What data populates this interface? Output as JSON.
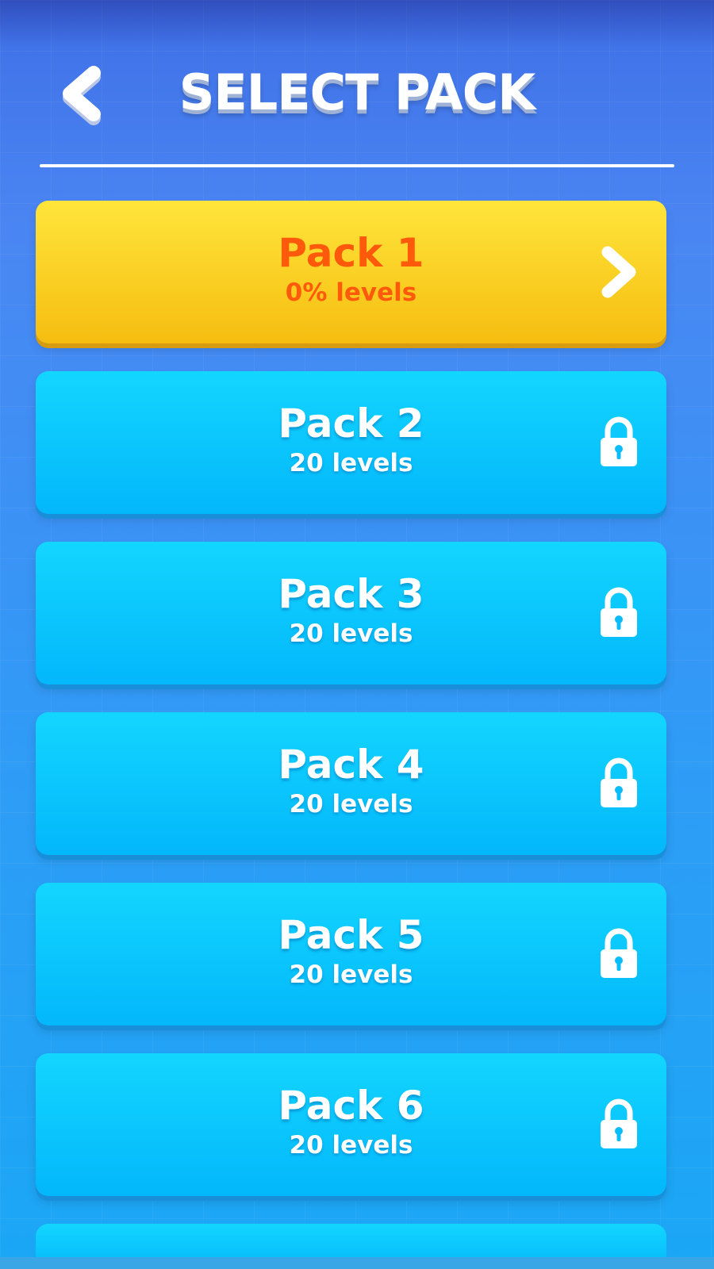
{
  "header": {
    "title": "SELECT PACK",
    "back_icon": "chevron-left-icon"
  },
  "colors": {
    "background": "#3f86f2",
    "active_pack": "#f9c91c",
    "active_text": "#ff5a0b",
    "locked_pack": "#0ac6fd",
    "locked_text": "#ffffff"
  },
  "packs": [
    {
      "name": "Pack 1",
      "subtitle": "0% levels",
      "state": "unlocked",
      "icon": "chevron-right-icon"
    },
    {
      "name": "Pack 2",
      "subtitle": "20 levels",
      "state": "locked",
      "icon": "lock-icon"
    },
    {
      "name": "Pack 3",
      "subtitle": "20 levels",
      "state": "locked",
      "icon": "lock-icon"
    },
    {
      "name": "Pack 4",
      "subtitle": "20 levels",
      "state": "locked",
      "icon": "lock-icon"
    },
    {
      "name": "Pack 5",
      "subtitle": "20 levels",
      "state": "locked",
      "icon": "lock-icon"
    },
    {
      "name": "Pack 6",
      "subtitle": "20 levels",
      "state": "locked",
      "icon": "lock-icon"
    }
  ]
}
